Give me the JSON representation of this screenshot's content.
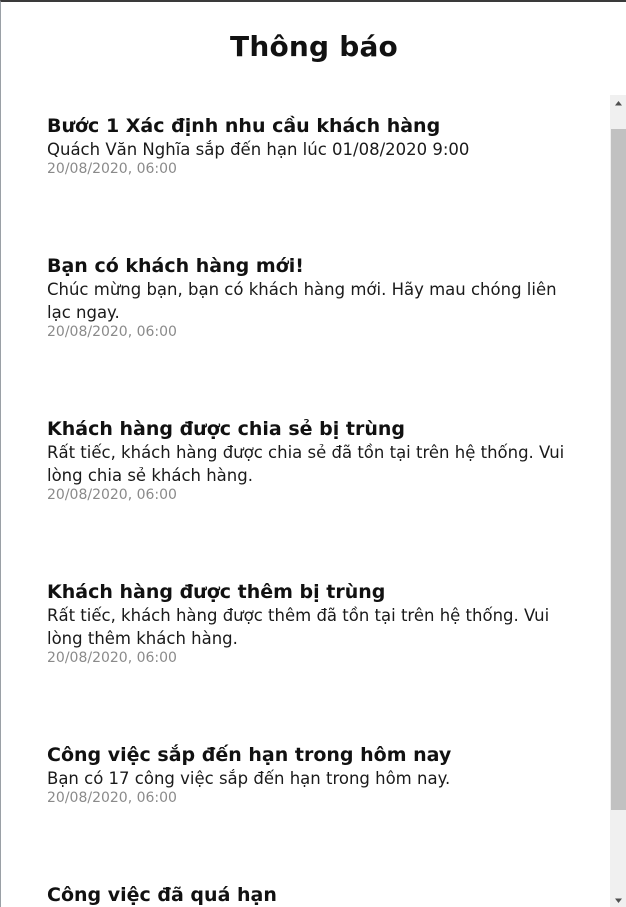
{
  "header": {
    "title": "Thông báo"
  },
  "notifications": [
    {
      "title": "Bước 1 Xác định nhu cầu khách hàng",
      "body": "Quách Văn Nghĩa sắp đến hạn lúc 01/08/2020 9:00",
      "time": "20/08/2020, 06:00"
    },
    {
      "title": "Bạn có khách hàng mới!",
      "body": "Chúc mừng bạn, bạn có khách hàng mới. Hãy mau chóng liên lạc ngay.",
      "time": "20/08/2020, 06:00"
    },
    {
      "title": "Khách hàng được chia sẻ bị trùng",
      "body": "Rất tiếc, khách hàng được chia sẻ đã tồn tại trên hệ thống. Vui lòng chia sẻ khách hàng.",
      "time": "20/08/2020, 06:00"
    },
    {
      "title": "Khách hàng được thêm bị trùng",
      "body": "Rất tiếc, khách hàng được thêm đã tồn tại trên hệ thống. Vui lòng thêm khách hàng.",
      "time": "20/08/2020, 06:00"
    },
    {
      "title": "Công việc sắp đến hạn trong hôm nay",
      "body": "Bạn có 17 công việc sắp đến hạn trong hôm nay.",
      "time": "20/08/2020, 06:00"
    },
    {
      "title": "Công việc đã quá hạn",
      "body": "",
      "time": ""
    }
  ],
  "scrollbar": {
    "up_icon": "triangle-up-icon",
    "down_icon": "triangle-down-icon",
    "track_color": "#f0f0f0",
    "thumb_color": "#c1c1c1"
  }
}
